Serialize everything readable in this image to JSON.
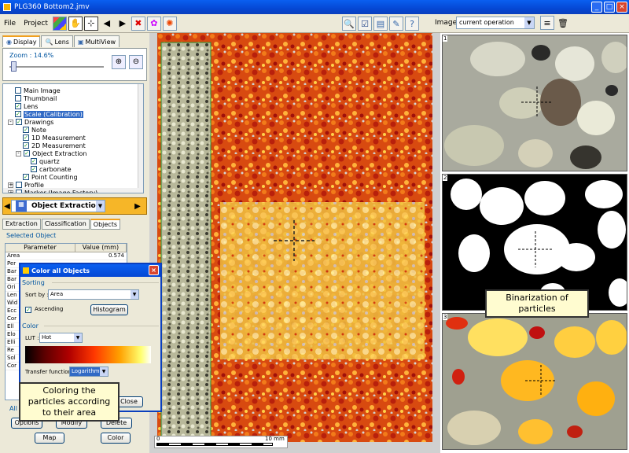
{
  "window": {
    "title": "PLG360 Bottom2.jmv"
  },
  "menu": [
    "File",
    "Project"
  ],
  "image_selector": {
    "label": "Image :",
    "value": "current operation"
  },
  "left": {
    "tabs": [
      "Display",
      "Lens",
      "MultiView"
    ],
    "zoom_label": "Zoom : 14.6%",
    "tree": [
      {
        "label": "Main Image",
        "checked": false,
        "indent": 0,
        "exp": ""
      },
      {
        "label": "Thumbnail",
        "checked": false,
        "indent": 0,
        "exp": ""
      },
      {
        "label": "Lens",
        "checked": true,
        "indent": 0,
        "exp": ""
      },
      {
        "label": "Scale (Calibration)",
        "checked": true,
        "indent": 0,
        "exp": "",
        "selected": true
      },
      {
        "label": "Drawings",
        "checked": true,
        "indent": 0,
        "exp": "-"
      },
      {
        "label": "Note",
        "checked": true,
        "indent": 1,
        "exp": ""
      },
      {
        "label": "1D Measurement",
        "checked": true,
        "indent": 1,
        "exp": ""
      },
      {
        "label": "2D Measurement",
        "checked": true,
        "indent": 1,
        "exp": ""
      },
      {
        "label": "Object Extraction",
        "checked": true,
        "indent": 1,
        "exp": "-"
      },
      {
        "label": "quartz",
        "checked": true,
        "indent": 2,
        "exp": ""
      },
      {
        "label": "carbonate",
        "checked": true,
        "indent": 2,
        "exp": ""
      },
      {
        "label": "Point Counting",
        "checked": true,
        "indent": 1,
        "exp": ""
      },
      {
        "label": "Profile",
        "checked": false,
        "indent": 0,
        "exp": "+"
      },
      {
        "label": "Marker (Image Factory)",
        "checked": false,
        "indent": 0,
        "exp": "+"
      }
    ],
    "module": "Object Extraction",
    "subtabs": [
      "Extraction",
      "Classification",
      "Objects"
    ],
    "selected_object_label": "Selected Object",
    "table_headers": [
      "Parameter",
      "Value (mm)"
    ],
    "table_rows": [
      [
        "Area",
        "0.574"
      ],
      [
        "Per",
        ""
      ],
      [
        "Bar",
        ""
      ],
      [
        "Bar",
        ""
      ],
      [
        "Ori",
        ""
      ],
      [
        "Len",
        ""
      ],
      [
        "Wid",
        ""
      ],
      [
        "Ecc",
        ""
      ],
      [
        "Cor",
        ""
      ],
      [
        "Ell",
        ""
      ],
      [
        "Elo",
        ""
      ],
      [
        "Elli",
        ""
      ],
      [
        "Re",
        ""
      ],
      [
        "Sol",
        ""
      ],
      [
        "Cor",
        ""
      ]
    ],
    "all_objects_label": "All",
    "buttons": {
      "options": "Options",
      "modify": "Modify",
      "delete": "Delete",
      "map": "Map",
      "color": "Color"
    }
  },
  "dialog": {
    "title": "Color all Objects",
    "sorting_label": "Sorting",
    "sort_by_label": "Sort by :",
    "sort_by_value": "Area",
    "ascending_label": "Ascending",
    "ascending_checked": true,
    "histogram_button": "Histogram",
    "color_label": "Color",
    "lut_label": "LUT :",
    "lut_value": "Hot",
    "transfer_label": "Transfer function :",
    "transfer_value": "Logarithmic",
    "close_button": "Close"
  },
  "scale_bar": {
    "start": "0",
    "end": "10 mm"
  },
  "panels": [
    {
      "number": "1"
    },
    {
      "number": "2",
      "caption": "Binarization of particles"
    },
    {
      "number": "3"
    }
  ],
  "callout_left": "Coloring the particles according to their area",
  "icons": [
    "hand-icon",
    "zoom-select-icon",
    "prev-icon",
    "next-icon",
    "delete-icon",
    "palette-icon",
    "search-icon",
    "check-icon",
    "layout-icon",
    "edit-icon",
    "help-icon"
  ]
}
